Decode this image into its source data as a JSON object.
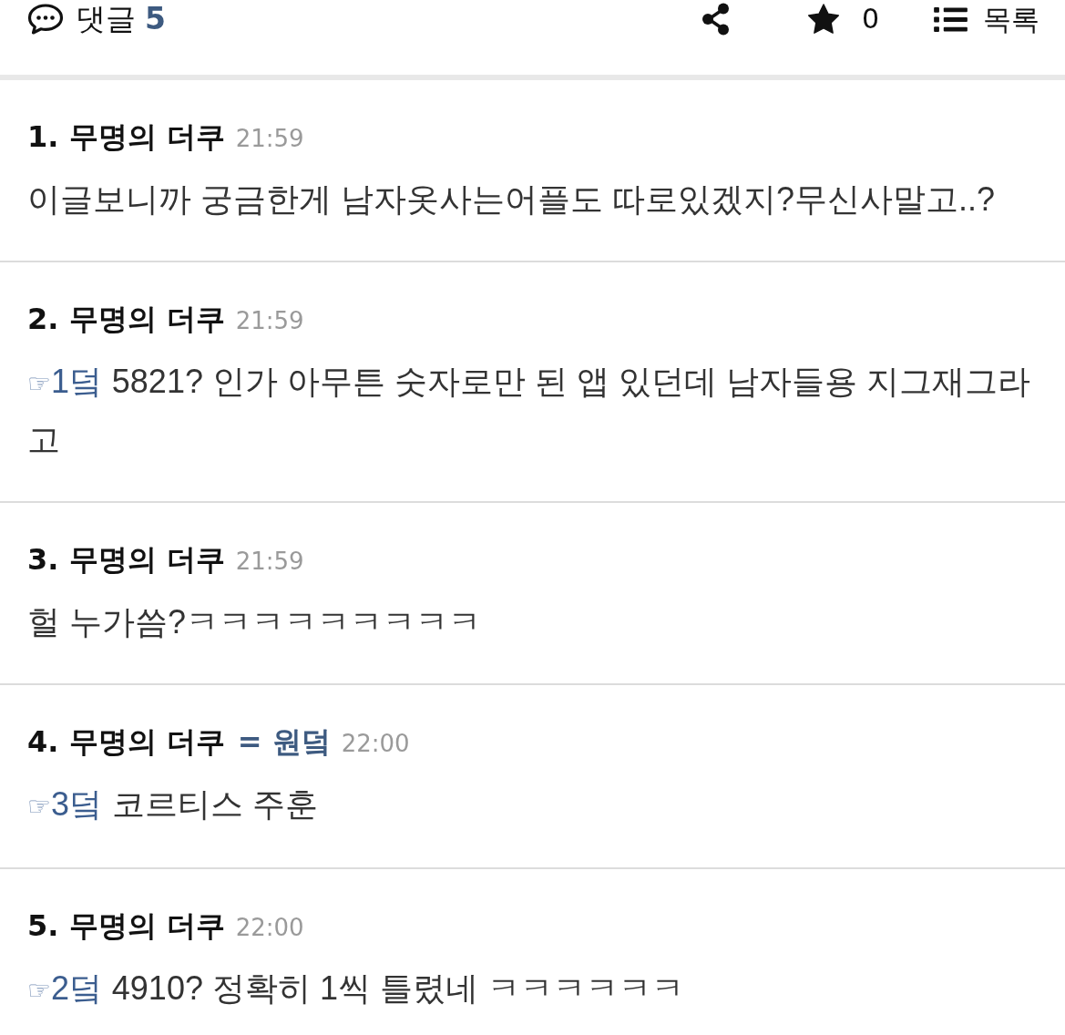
{
  "header": {
    "title": "댓글",
    "count": "5",
    "star_count": "0",
    "list_label": "목록"
  },
  "comments": [
    {
      "heading": "1. 무명의 더쿠",
      "time": "21:59",
      "body": "이글보니까 궁금한게 남자옷사는어플도 따로있겠지?무신사말고..?"
    },
    {
      "heading": "2. 무명의 더쿠",
      "time": "21:59",
      "reply": {
        "hand": "☞",
        "target": "1덬"
      },
      "body": "5821? 인가 아무튼 숫자로만 된 앱 있던데 남자들용 지그재그라고"
    },
    {
      "heading": "3. 무명의 더쿠",
      "time": "21:59",
      "body": "헐 누가씀?ㅋㅋㅋㅋㅋㅋㅋㅋㅋ"
    },
    {
      "heading": "4. 무명의 더쿠",
      "author_tag": "= 원덬",
      "time": "22:00",
      "reply": {
        "hand": "☞",
        "target": "3덬"
      },
      "body": "코르티스 주훈"
    },
    {
      "heading": "5. 무명의 더쿠",
      "time": "22:00",
      "reply": {
        "hand": "☞",
        "target": "2덬"
      },
      "body": "4910? 정확히 1씩 틀렸네 ㅋㅋㅋㅋㅋㅋ"
    }
  ]
}
